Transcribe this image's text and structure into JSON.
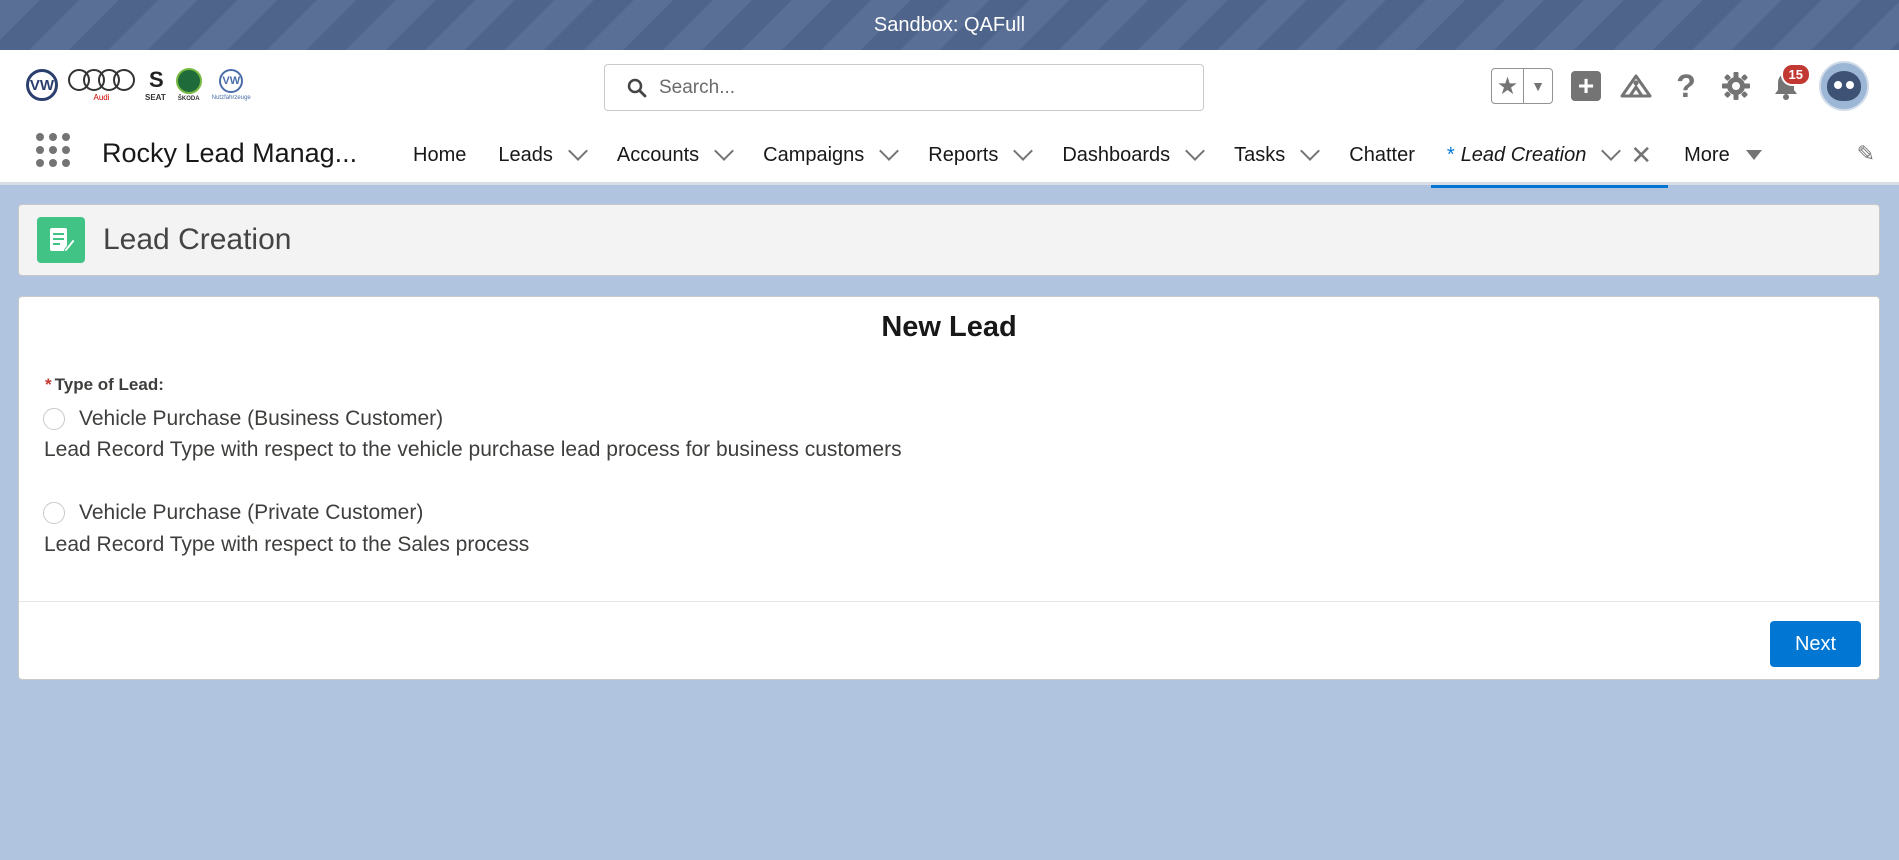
{
  "sandbox": {
    "label": "Sandbox: QAFull"
  },
  "header": {
    "logos": {
      "vw": "VW",
      "audi_caption": "Audi",
      "seat": "S",
      "seat_caption": "SEAT",
      "skoda_caption": "ŠKODA",
      "vwc": "VW",
      "vwc_caption": "Nutzfahrzeuge"
    },
    "search": {
      "placeholder": "Search..."
    },
    "notifications_count": "15"
  },
  "nav": {
    "app_name": "Rocky Lead Manag...",
    "items": [
      {
        "label": "Home"
      },
      {
        "label": "Leads"
      },
      {
        "label": "Accounts"
      },
      {
        "label": "Campaigns"
      },
      {
        "label": "Reports"
      },
      {
        "label": "Dashboards"
      },
      {
        "label": "Tasks"
      },
      {
        "label": "Chatter"
      }
    ],
    "active_tab": {
      "prefix": "*",
      "label": "Lead Creation"
    },
    "more": "More"
  },
  "page": {
    "title": "Lead Creation"
  },
  "form": {
    "title": "New Lead",
    "required_mark": "*",
    "field_label": "Type of Lead:",
    "options": [
      {
        "label": "Vehicle Purchase (Business Customer)",
        "description": "Lead Record Type with respect to the vehicle purchase lead process for business customers"
      },
      {
        "label": "Vehicle Purchase (Private Customer)",
        "description": "Lead Record Type with respect to the Sales process"
      }
    ],
    "next_label": "Next"
  },
  "colors": {
    "brand": "#0176d3",
    "page_bg": "#b0c4df",
    "record_icon": "#41c385"
  }
}
